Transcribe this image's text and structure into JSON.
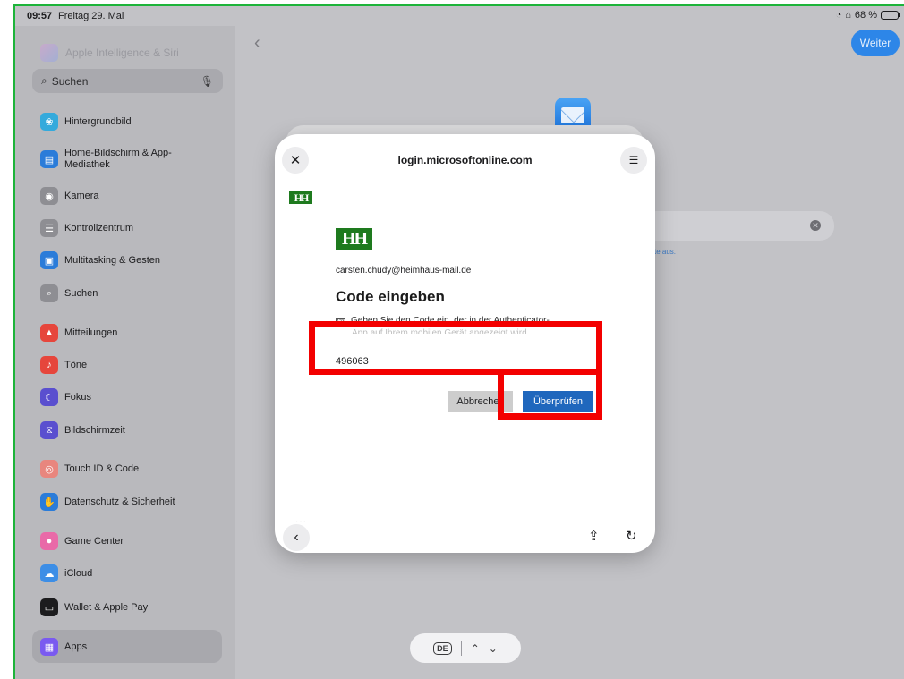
{
  "statusbar": {
    "time": "09:57",
    "date": "Freitag 29. Mai",
    "battery": "68 %",
    "battery_level": 0.68
  },
  "sidebar": {
    "faded_item": "Apple Intelligence & Siri",
    "search_placeholder": "Suchen",
    "items": [
      {
        "label": "Hintergrundbild",
        "icon": "wallpaper-icon",
        "color": "#34aadc"
      },
      {
        "label": "Home-Bildschirm & App-Mediathek",
        "icon": "home-screen-icon",
        "color": "#2b7cd9"
      },
      {
        "label": "Kamera",
        "icon": "camera-icon",
        "color": "#8e8e93"
      },
      {
        "label": "Kontrollzentrum",
        "icon": "control-center-icon",
        "color": "#8e8e93"
      },
      {
        "label": "Multitasking & Gesten",
        "icon": "multitasking-icon",
        "color": "#2b7cd9"
      },
      {
        "label": "Suchen",
        "icon": "search-icon",
        "color": "#8e8e93"
      },
      {
        "label": "Mitteilungen",
        "icon": "notifications-icon",
        "color": "#e6463c"
      },
      {
        "label": "Töne",
        "icon": "sounds-icon",
        "color": "#e6463c"
      },
      {
        "label": "Fokus",
        "icon": "focus-icon",
        "color": "#5a4fcf"
      },
      {
        "label": "Bildschirmzeit",
        "icon": "screen-time-icon",
        "color": "#5a4fcf"
      },
      {
        "label": "Touch ID & Code",
        "icon": "fingerprint-icon",
        "color": "#e8867e"
      },
      {
        "label": "Datenschutz & Sicherheit",
        "icon": "privacy-hand-icon",
        "color": "#2b7cd9"
      },
      {
        "label": "Game Center",
        "icon": "game-center-icon",
        "color": "#e96aa8"
      },
      {
        "label": "iCloud",
        "icon": "icloud-icon",
        "color": "#3d8ee6"
      },
      {
        "label": "Wallet & Apple Pay",
        "icon": "wallet-icon",
        "color": "#1c1c1e"
      },
      {
        "label": "Apps",
        "icon": "apps-grid-icon",
        "color": "#7a5af0"
      }
    ]
  },
  "background": {
    "weiter_label": "Weiter",
    "link_fragment": "te aus."
  },
  "modal": {
    "url": "login.microsoftonline.com",
    "logo_text": "HH",
    "email": "carsten.chudy@heimhaus-mail.de",
    "heading": "Code eingeben",
    "instruction": "Geben Sie den Code ein, der in der Authenticator-",
    "instruction_cont": "App auf Ihrem mobilen Gerät angezeigt wird",
    "code_value": "496063",
    "cancel_label": "Abbrechen",
    "verify_label": "Überprüfen",
    "dots": "···"
  },
  "keyboard_bar": {
    "lang": "DE"
  },
  "colors": {
    "annotation": "#f30000",
    "accent": "#1f67bd",
    "frame": "#1db43a"
  }
}
